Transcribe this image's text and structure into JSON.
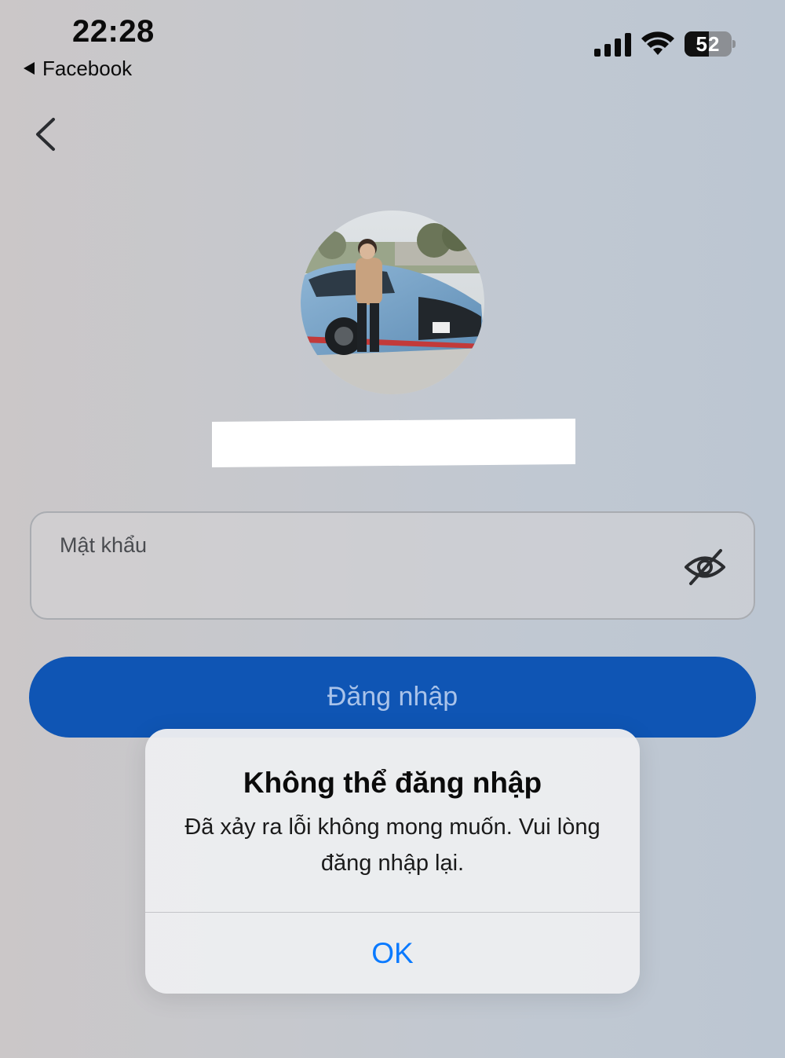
{
  "status_bar": {
    "time": "22:28",
    "back_app_label": "Facebook",
    "battery_percent": "52",
    "battery_level": 0.52,
    "signal_icon": "cellular-signal-icon",
    "wifi_icon": "wifi-icon"
  },
  "nav": {
    "back_icon": "chevron-left-icon"
  },
  "profile": {
    "avatar_icon": "profile-photo"
  },
  "login_form": {
    "password_label": "Mật khẩu",
    "password_value": "",
    "visibility_icon": "eye-slash-icon",
    "login_button_label": "Đăng nhập"
  },
  "alert": {
    "title": "Không thể đăng nhập",
    "message": "Đã xảy ra lỗi không mong muốn. Vui lòng đăng nhập lại.",
    "ok_label": "OK"
  },
  "colors": {
    "accent_blue": "#0f55b4",
    "ios_link_blue": "#0a7aff"
  }
}
